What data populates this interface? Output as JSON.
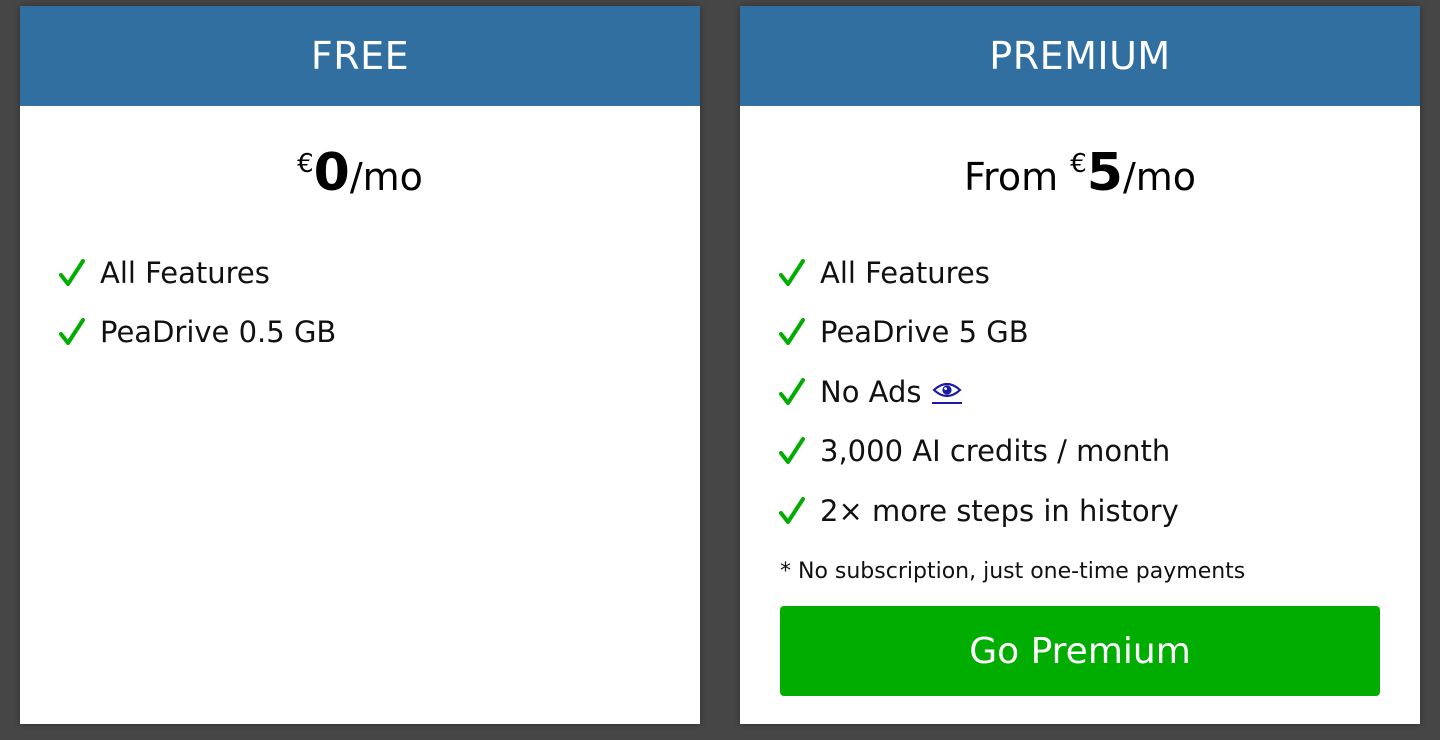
{
  "plans": {
    "free": {
      "title": "FREE",
      "price_prefix": "",
      "currency": "€",
      "amount": "0",
      "period": "/mo",
      "features": [
        {
          "label": "All Features"
        },
        {
          "label": "PeaDrive 0.5 GB"
        }
      ]
    },
    "premium": {
      "title": "PREMIUM",
      "price_prefix": "From ",
      "currency": "€",
      "amount": "5",
      "period": "/mo",
      "features": [
        {
          "label": "All Features"
        },
        {
          "label": "PeaDrive 5 GB"
        },
        {
          "label": "No Ads",
          "icon": "eye-icon"
        },
        {
          "label": "3,000 AI credits / month"
        },
        {
          "label": "2× more steps in history"
        }
      ],
      "note": "* No subscription, just one-time payments",
      "cta_label": "Go Premium"
    }
  },
  "colors": {
    "background": "#464646",
    "header": "#306fa0",
    "check": "#00ad00",
    "cta": "#00ad00",
    "link": "#1a1aa6"
  },
  "icons": {
    "check": "check-icon",
    "eye": "eye-icon"
  }
}
